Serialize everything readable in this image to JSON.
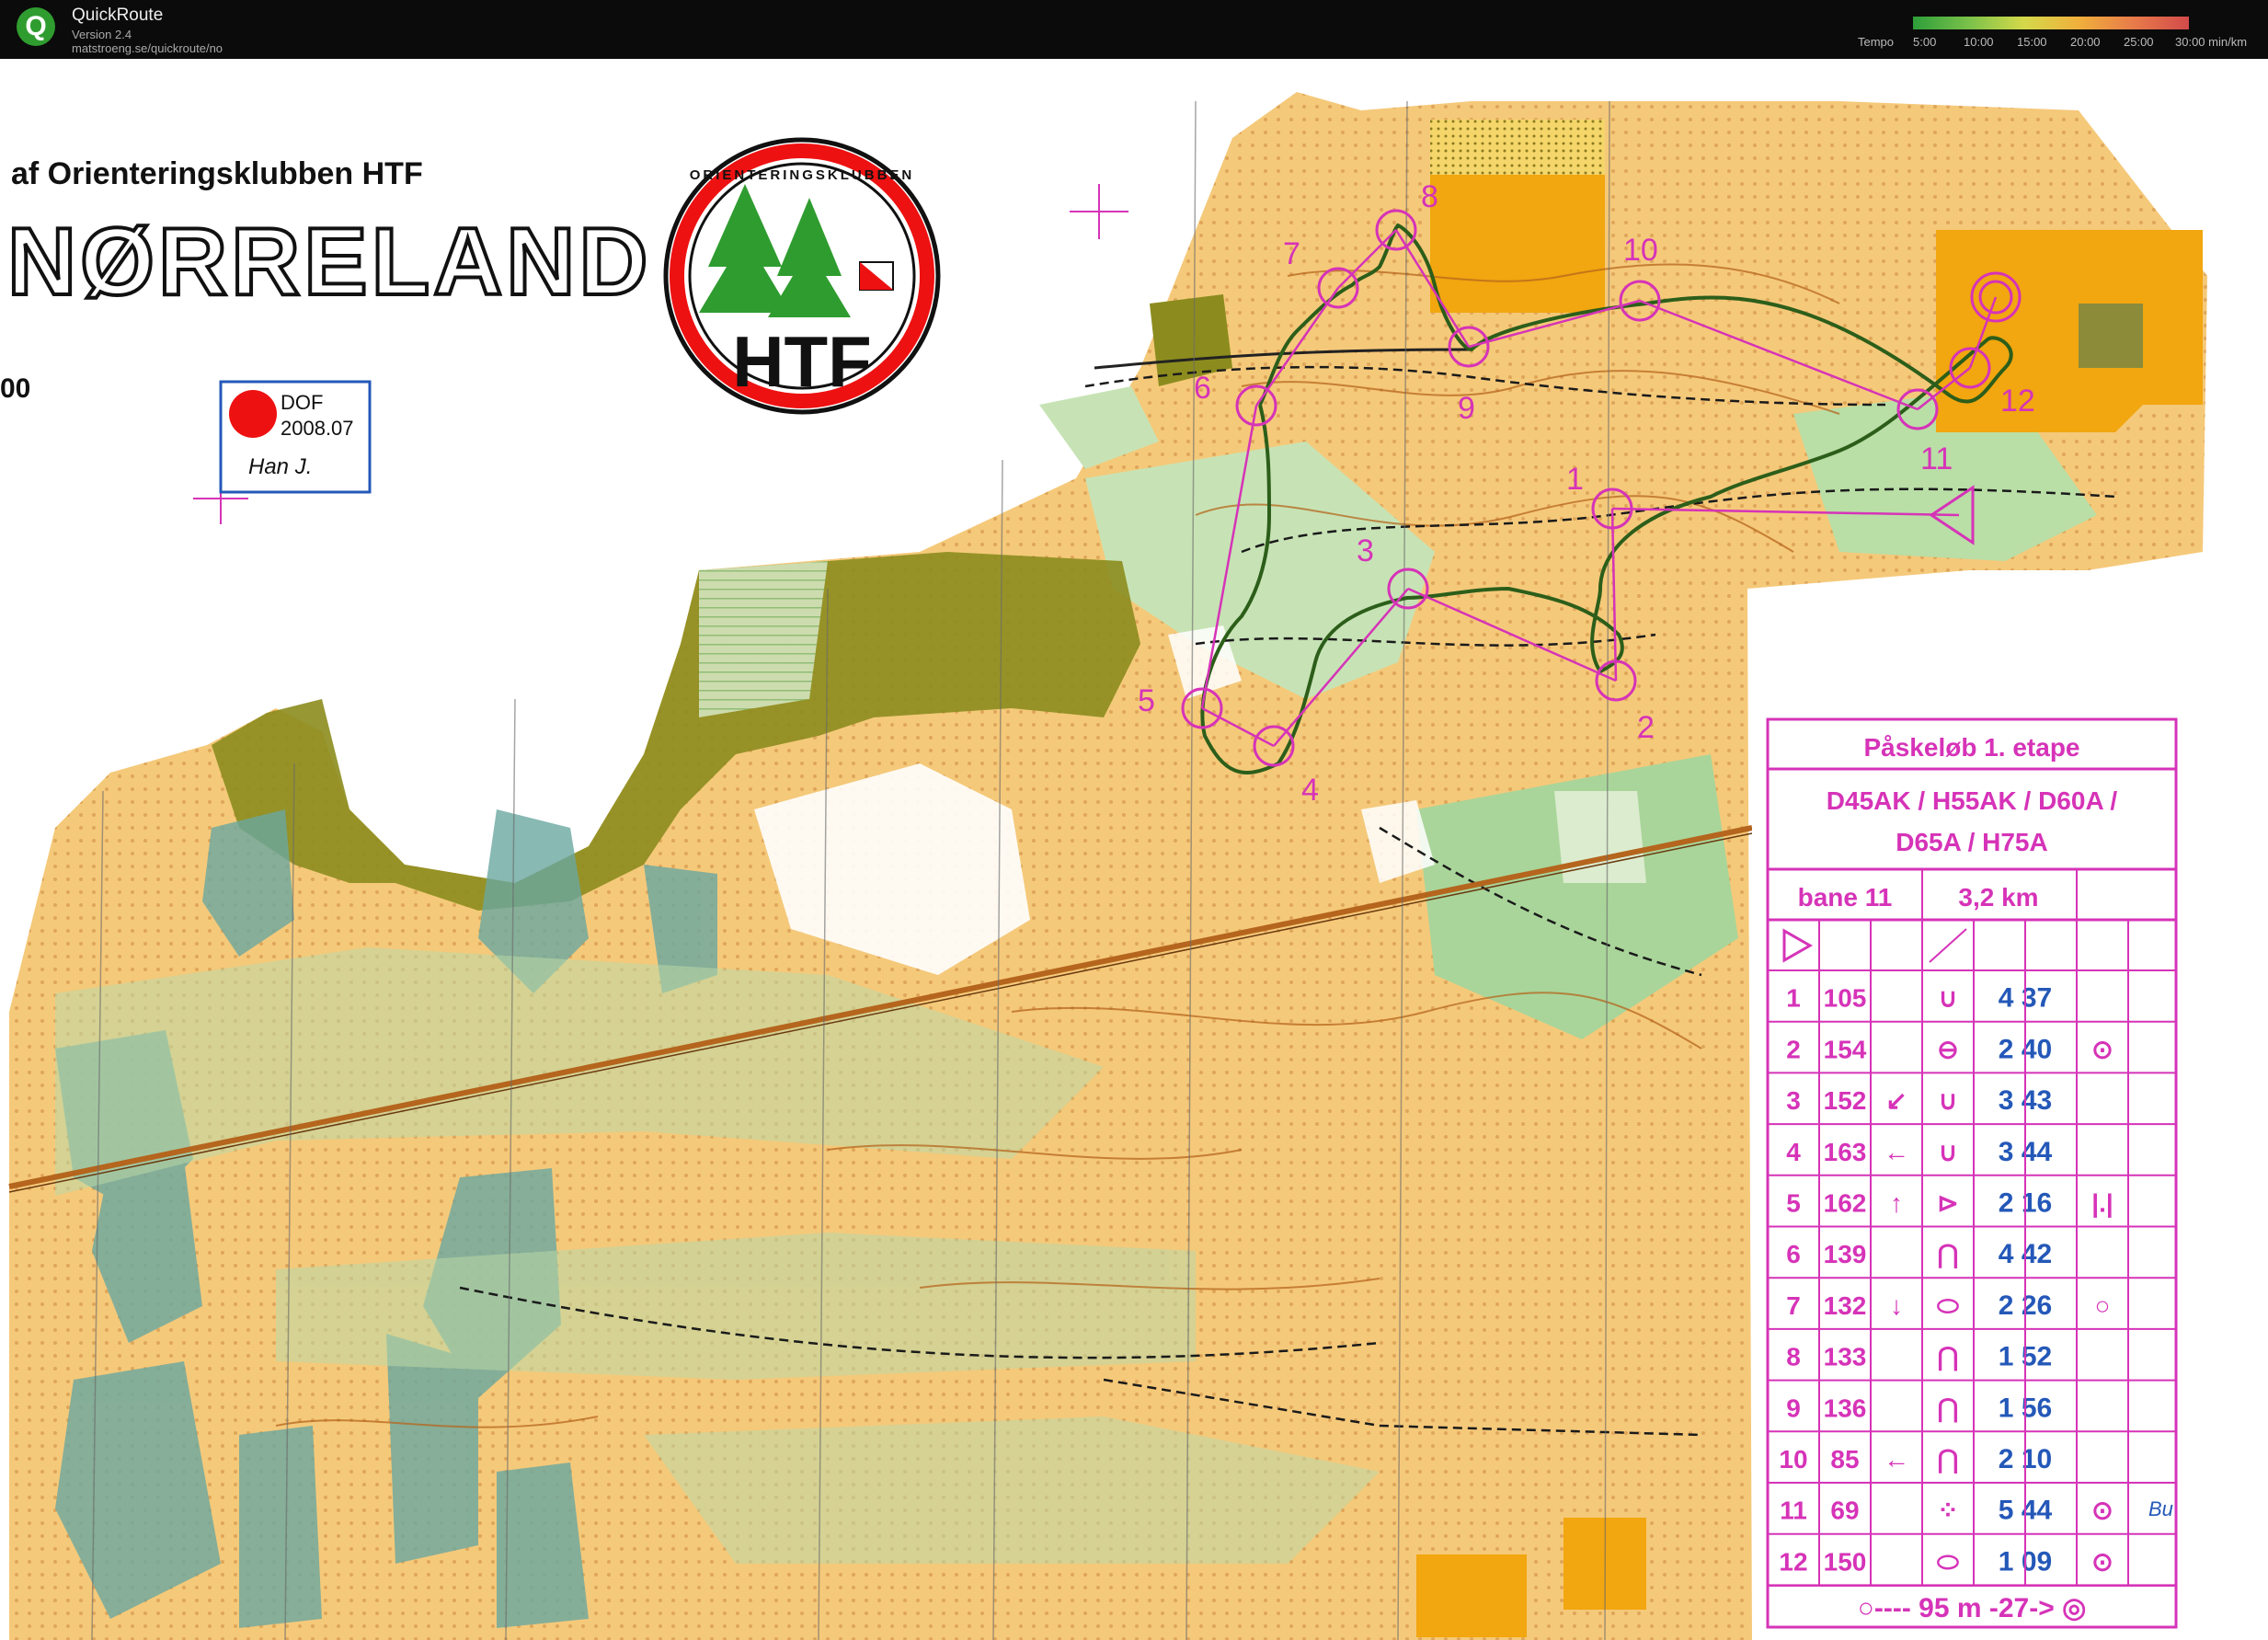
{
  "app": {
    "name": "QuickRoute",
    "version": "Version 2.4",
    "url": "matstroeng.se/quickroute/no",
    "tempo_label": "Tempo",
    "tempo_ticks": [
      "5:00",
      "10:00",
      "15:00",
      "20:00",
      "25:00",
      "30:00 min/km"
    ]
  },
  "map": {
    "club_line": "af Orienteringsklubben HTF",
    "area_name": "NØRRELAND",
    "scale_fragment": "00",
    "club_badge_ring": "ORIENTERINGSKLUBBEN",
    "club_badge": "HTF",
    "dof_label": "DOF",
    "dof_year": "2008.07",
    "dof_signature": "Han J."
  },
  "control_numbers": [
    "1",
    "2",
    "3",
    "4",
    "5",
    "6",
    "7",
    "8",
    "9",
    "10",
    "11",
    "12"
  ],
  "course": {
    "title": "Påskeløb 1. etape",
    "classes_line1": "D45AK / H55AK / D60A /",
    "classes_line2": "D65A / H75A",
    "bane": "bane 11",
    "length": "3,2 km",
    "rows": [
      {
        "num": "1",
        "code": "105",
        "dir": "",
        "feat": "∪",
        "dims": "4 37",
        "extra": ""
      },
      {
        "num": "2",
        "code": "154",
        "dir": "",
        "feat": "⊖",
        "dims": "2 40",
        "extra": "⊙"
      },
      {
        "num": "3",
        "code": "152",
        "dir": "↙",
        "feat": "∪",
        "dims": "3 43",
        "extra": ""
      },
      {
        "num": "4",
        "code": "163",
        "dir": "←",
        "feat": "∪",
        "dims": "3 44",
        "extra": ""
      },
      {
        "num": "5",
        "code": "162",
        "dir": "↑",
        "feat": "⊳",
        "dims": "2 16",
        "extra": "|.|"
      },
      {
        "num": "6",
        "code": "139",
        "dir": "",
        "feat": "⋂",
        "dims": "4 42",
        "extra": ""
      },
      {
        "num": "7",
        "code": "132",
        "dir": "↓",
        "feat": "⬭",
        "dims": "2 26",
        "extra": "○"
      },
      {
        "num": "8",
        "code": "133",
        "dir": "",
        "feat": "⋂",
        "dims": "1 52",
        "extra": ""
      },
      {
        "num": "9",
        "code": "136",
        "dir": "",
        "feat": "⋂",
        "dims": "1 56",
        "extra": ""
      },
      {
        "num": "10",
        "code": "85",
        "dir": "←",
        "feat": "⋂",
        "dims": "2 10",
        "extra": ""
      },
      {
        "num": "11",
        "code": "69",
        "dir": "",
        "feat": "⁘",
        "dims": "5 44",
        "extra": "⊙"
      },
      {
        "num": "12",
        "code": "150",
        "dir": "",
        "feat": "⬭",
        "dims": "1 09",
        "extra": "⊙"
      }
    ],
    "finish": "○---- 95 m -27-> ◎",
    "margin_note": "Bu"
  },
  "colors": {
    "overprint": "#d633b8",
    "open": "#f5c97a",
    "open_rough": "#f0d8a0",
    "forest_green": "#7fc27a",
    "light_green": "#c7e3b5",
    "water": "#6aa8a0",
    "olive": "#8c8c1e",
    "yellow": "#f2a60f",
    "contour": "#b5651d"
  }
}
